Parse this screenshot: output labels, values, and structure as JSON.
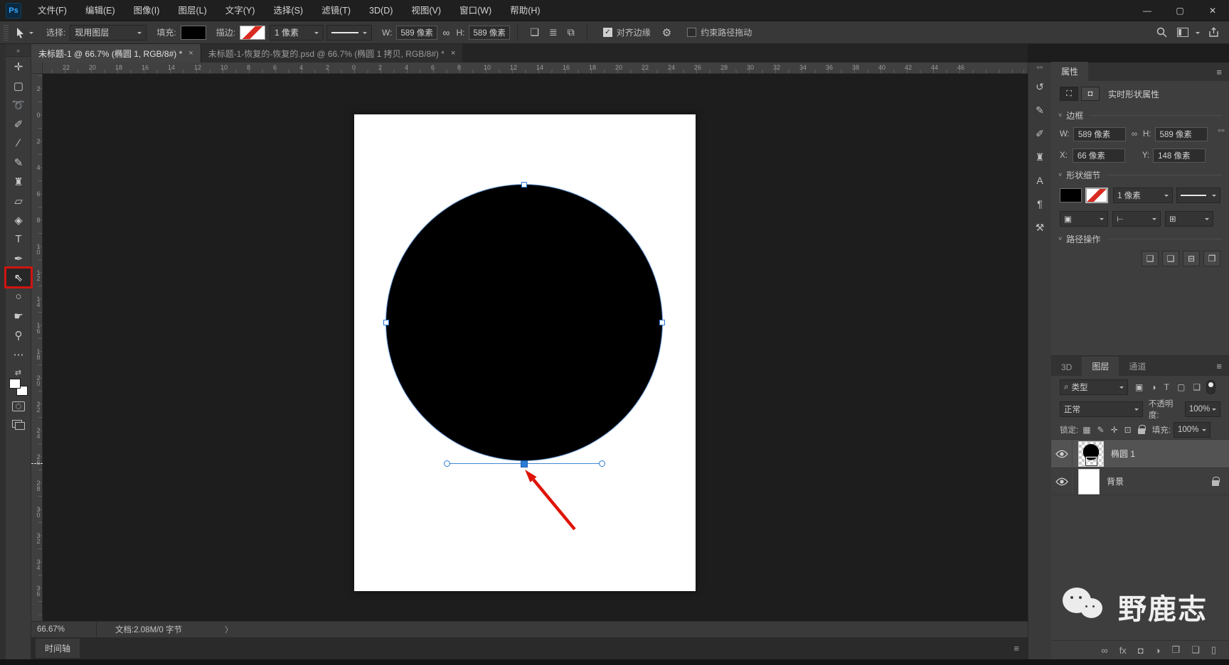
{
  "window": {
    "app_badge": "Ps",
    "controls": [
      {
        "name": "minimize-button",
        "glyph": "—"
      },
      {
        "name": "maximize-button",
        "glyph": "▢"
      },
      {
        "name": "close-button",
        "glyph": "✕"
      }
    ]
  },
  "menubar": {
    "items": [
      "文件(F)",
      "编辑(E)",
      "图像(I)",
      "图层(L)",
      "文字(Y)",
      "选择(S)",
      "滤镜(T)",
      "3D(D)",
      "视图(V)",
      "窗口(W)",
      "帮助(H)"
    ]
  },
  "options": {
    "select_label": "选择:",
    "select_value": "现用图层",
    "fill_label": "填充:",
    "stroke_label": "描边:",
    "stroke_width": "1 像素",
    "w_label": "W:",
    "w_value": "589 像素",
    "link_glyph": "∞",
    "h_label": "H:",
    "h_value": "589 像素",
    "path_icons": [
      {
        "name": "path-operations-icon",
        "glyph": "❑"
      },
      {
        "name": "path-alignment-icon",
        "glyph": "≣"
      },
      {
        "name": "path-arrange-icon",
        "glyph": "⧉"
      }
    ],
    "check_glyph": "✓",
    "align_edges_label": "对齐边缘",
    "gear_glyph": "⚙",
    "constrain_label": "约束路径拖动"
  },
  "tabs": [
    {
      "title": "未标题-1 @ 66.7% (椭圆 1, RGB/8#) *",
      "close": "×"
    },
    {
      "title": "未标题-1-恢复的-恢复的.psd @ 66.7% (椭圆 1 拷贝, RGB/8#) *",
      "close": "×"
    }
  ],
  "toolbar": {
    "expand_glyph": "»",
    "tools": [
      {
        "name": "move-tool",
        "glyph": "✛"
      },
      {
        "name": "rectangular-marquee-tool",
        "glyph": "▢"
      },
      {
        "name": "lasso-tool",
        "glyph": "➰"
      },
      {
        "name": "quick-selection-tool",
        "glyph": "✐"
      },
      {
        "name": "eyedropper-tool",
        "glyph": "∕"
      },
      {
        "name": "brush-tool",
        "glyph": "✎"
      },
      {
        "name": "clone-stamp-tool",
        "glyph": "♜"
      },
      {
        "name": "eraser-tool",
        "glyph": "▱"
      },
      {
        "name": "paint-bucket-tool",
        "glyph": "◈"
      },
      {
        "name": "type-tool",
        "glyph": "T"
      },
      {
        "name": "pen-tool",
        "glyph": "✒"
      },
      {
        "name": "direct-selection-tool",
        "glyph": "⇖",
        "selected": true,
        "redbox": true
      },
      {
        "name": "ellipse-tool",
        "glyph": "○"
      },
      {
        "name": "hand-tool",
        "glyph": "☛"
      },
      {
        "name": "zoom-tool",
        "glyph": "⚲"
      },
      {
        "name": "edit-toolbar-button",
        "glyph": "⋯"
      }
    ]
  },
  "rulers": {
    "h": [
      "22",
      "20",
      "18",
      "16",
      "14",
      "12",
      "10",
      "8",
      "6",
      "4",
      "2",
      "0",
      "2",
      "4",
      "6",
      "8",
      "10",
      "12",
      "14",
      "16",
      "18",
      "20",
      "22",
      "24",
      "26",
      "28",
      "30",
      "32",
      "34",
      "36",
      "38",
      "40",
      "42",
      "44",
      "46"
    ],
    "v": [
      "2",
      "0",
      "2",
      "4",
      "6",
      "8",
      "10",
      "12",
      "14",
      "16",
      "18",
      "20",
      "22",
      "24",
      "26",
      "28",
      "30",
      "32",
      "34",
      "36"
    ]
  },
  "panel_strip": {
    "collapse_glyph": "««",
    "expand_glyph": "»»",
    "icons": [
      {
        "name": "history-panel-icon",
        "glyph": "↺"
      },
      {
        "name": "brush-settings-panel-icon",
        "glyph": "✎"
      },
      {
        "name": "brushes-panel-icon",
        "glyph": "✐"
      },
      {
        "name": "clone-source-panel-icon",
        "glyph": "♜"
      },
      {
        "name": "character-panel-icon",
        "glyph": "A"
      },
      {
        "name": "paragraph-panel-icon",
        "glyph": "¶"
      },
      {
        "name": "tool-presets-panel-icon",
        "glyph": "⚒"
      }
    ]
  },
  "properties": {
    "tab": "属性",
    "menu_glyph": "≡",
    "transform_glyph": "⛶",
    "mask_glyph": "◘",
    "live_shape_label": "实时形状属性",
    "sections": {
      "bounds": "边框",
      "shape_details": "形状细节",
      "path_ops": "路径操作"
    },
    "w_label": "W:",
    "w_value": "589 像素",
    "h_label": "H:",
    "h_value": "589 像素",
    "x_label": "X:",
    "x_value": "66 像素",
    "y_label": "Y:",
    "y_value": "148 像素",
    "link_glyph": "∞",
    "stroke_width": "1 像素",
    "detail_selects": [
      {
        "name": "stroke-align-select",
        "glyph": "▣"
      },
      {
        "name": "stroke-caps-select",
        "glyph": "⊢"
      },
      {
        "name": "stroke-corners-select",
        "glyph": "⊞"
      }
    ],
    "path_op_buttons": [
      {
        "name": "merge-shapes-button",
        "glyph": "❑"
      },
      {
        "name": "subtract-shape-button",
        "glyph": "❏"
      },
      {
        "name": "intersect-shapes-button",
        "glyph": "⊟"
      },
      {
        "name": "exclude-shapes-button",
        "glyph": "❒"
      }
    ]
  },
  "layers": {
    "tabs": {
      "t3d": "3D",
      "tlayers": "图层",
      "tchannels": "通道"
    },
    "menu_glyph": "≡",
    "search_glyph": "⌕",
    "filter_label": "类型",
    "filter_icons": [
      {
        "name": "filter-pixel-layers-icon",
        "glyph": "▣"
      },
      {
        "name": "filter-adjustment-layers-icon",
        "glyph": "◑"
      },
      {
        "name": "filter-type-layers-icon",
        "glyph": "T"
      },
      {
        "name": "filter-shape-layers-icon",
        "glyph": "▢"
      },
      {
        "name": "filter-smart-objects-icon",
        "glyph": "❏"
      }
    ],
    "blend_mode": "正常",
    "opacity_label": "不透明度:",
    "opacity_value": "100%",
    "lock_label": "锁定:",
    "lock_icons": [
      {
        "name": "lock-transparent-pixels-icon",
        "glyph": "▦"
      },
      {
        "name": "lock-image-pixels-icon",
        "glyph": "✎"
      },
      {
        "name": "lock-position-icon",
        "glyph": "✛"
      },
      {
        "name": "lock-artboard-icon",
        "glyph": "⊡"
      }
    ],
    "fill_label": "填充:",
    "fill_value": "100%",
    "layer1_name": "椭圆 1",
    "layer2_name": "背景",
    "bottom_icons": [
      {
        "name": "link-layers-icon",
        "glyph": "∞"
      },
      {
        "name": "layer-style-icon",
        "glyph": "fx"
      },
      {
        "name": "add-layer-mask-icon",
        "glyph": "◘"
      },
      {
        "name": "adjustment-layer-icon",
        "glyph": "◑"
      },
      {
        "name": "new-group-icon",
        "glyph": "❒"
      },
      {
        "name": "new-layer-icon",
        "glyph": "❏"
      },
      {
        "name": "delete-layer-icon",
        "glyph": "▯"
      }
    ]
  },
  "status": {
    "zoom": "66.67%",
    "doc_info": "文档:2.08M/0 字节",
    "chevron": "〉"
  },
  "timeline": {
    "tab": "时间轴",
    "menu_glyph": "≡"
  },
  "watermark": {
    "text": "野鹿志"
  },
  "colors": {
    "accent_blue": "#2e7cd6",
    "annotation_red": "#cf1410",
    "canvas_bg": "#1d1d1d"
  }
}
